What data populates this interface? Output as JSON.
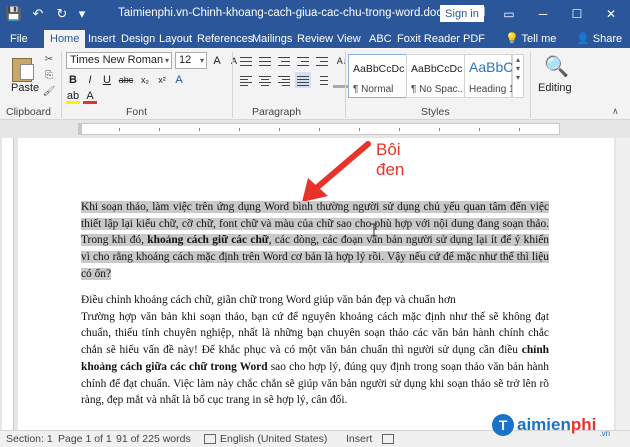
{
  "window": {
    "title": "Taimienphi.vn-Chinh-khoang-cach-giua-cac-chu-trong-word.docx  -  Word",
    "signin_label": "Sign in",
    "controls": {
      "ribbon_options": "▭",
      "minimize": "─",
      "maximize": "☐",
      "close": "✕"
    }
  },
  "qat": {
    "save": "💾",
    "undo": "↶",
    "redo": "↻",
    "customize": "▾"
  },
  "tabs": [
    "File",
    "Home",
    "Insert",
    "Design",
    "Layout",
    "References",
    "Mailings",
    "Review",
    "View",
    "ABC",
    "Foxit Reader PDF"
  ],
  "tell_me": "💡 Tell me",
  "share": "👤 Share",
  "ribbon": {
    "clipboard": {
      "paste_label": "Paste",
      "group_label": "Clipboard",
      "cut": "✂",
      "copy": "⎘",
      "format_painter": "🖌"
    },
    "font": {
      "name": "Times New Roman",
      "size": "12",
      "group_label": "Font",
      "row1": [
        "A",
        "A",
        "Aa",
        "A"
      ],
      "row2": [
        "B",
        "I",
        "U",
        "abc",
        "x₂",
        "x²",
        "A"
      ],
      "row3": [
        "A",
        "ab",
        "A"
      ]
    },
    "paragraph": {
      "group_label": "Paragraph",
      "sort": "A↓",
      "pilcrow": "¶"
    },
    "styles": {
      "group_label": "Styles",
      "items": [
        {
          "preview": "AaBbCcDc",
          "name": "¶ Normal"
        },
        {
          "preview": "AaBbCcDc",
          "name": "¶ No Spac..."
        },
        {
          "preview": "AaBbC",
          "name": "Heading 1"
        }
      ]
    },
    "editing": {
      "label": "Editing",
      "icon": "🔍"
    },
    "collapse_icon": "∧"
  },
  "annotation": {
    "line1": "Bôi",
    "line2": "đen"
  },
  "document": {
    "para1": {
      "a": "Khi soạn thảo, làm việc trên ứng dụng Word bình thường người sử dụng chủ yếu quan tâm đến việc thiết lập lại kiểu chữ, cỡ chữ, font chữ và màu của chữ sao cho phù hợp với nội dung đang soạn thảo. Trong khi đó, ",
      "b": "khoảng cách giữ các chữ",
      "c": ", các dòng, các đoạn văn bản người sử dụng lại ít để ý khiến vì cho rằng khoảng cách mặc định trên Word cơ bản là hợp lý rồi. Vậy nếu cứ để mặc như thế thì liệu có ổn?"
    },
    "para2_line1": "Điều chỉnh khoảng cách chữ, giãn chữ trong Word giúp văn bản đẹp và chuẩn hơn",
    "para3": {
      "a": "Trường hợp văn bản khi soạn thảo, bạn cứ để nguyên khoảng cách mặc định như thế sẽ không đạt chuẩn, thiếu tính chuyên nghiệp, nhất là những bạn chuyên soạn thảo các văn bản hành chính chắc chắn sẽ hiểu vấn đề này! Để khắc phục và có một văn bản chuẩn thì người sử dụng cần điều ",
      "b": "chỉnh khoảng cách giữa các chữ trong Word",
      "c": " sao cho hợp lý, đúng quy định trong soạn thảo văn bản hành chính để đạt chuẩn. Việc làm này chắc chắn sẽ giúp văn bản người sử dụng khi soạn thảo sẽ trở lên rõ ràng, đẹp mắt và nhất là bố cục trang in sẽ hợp lý, cân đối."
    }
  },
  "statusbar": {
    "section": "Section: 1",
    "page": "Page 1 of 1",
    "words": "91 of 225 words",
    "language": "English (United States)",
    "mode": "Insert"
  },
  "logo": {
    "mark": "T",
    "text_a": "aimien",
    "text_b": "phi",
    "suffix": ".vn"
  },
  "colors": {
    "accent": "#2b579a",
    "annotation": "#e8332a",
    "selection": "#c9c9c9"
  }
}
